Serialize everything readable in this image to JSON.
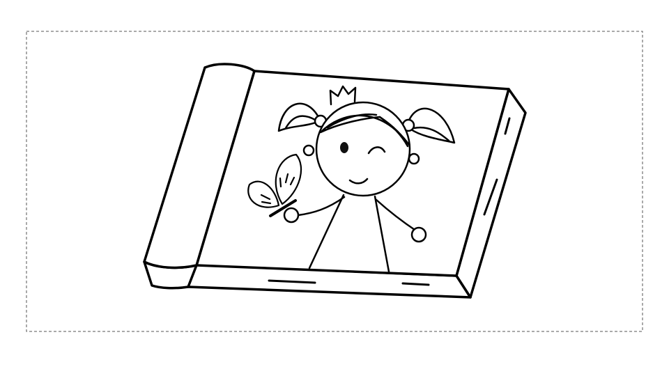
{
  "scene": {
    "frame": {
      "style": "dashed-border"
    },
    "illustration": {
      "subject": "line-drawing",
      "colors": {
        "stroke": "#000000",
        "fill": "#ffffff",
        "frame": "#555555"
      }
    }
  }
}
